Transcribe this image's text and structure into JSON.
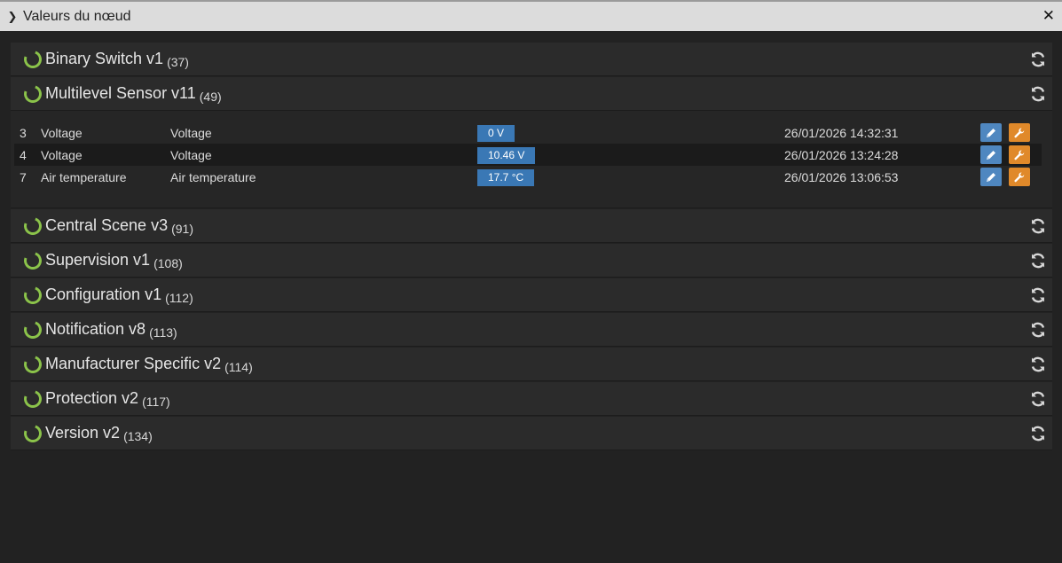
{
  "window": {
    "title": "Valeurs du nœud",
    "close_glyph": "✕"
  },
  "panels": [
    {
      "name": "Binary Switch v1",
      "id": "(37)"
    },
    {
      "name": "Multilevel Sensor v11",
      "id": "(49)",
      "rows": [
        {
          "index": "3",
          "label": "Voltage",
          "name": "Voltage",
          "value": "0 V",
          "date": "26/01/2026 14:32:31"
        },
        {
          "index": "4",
          "label": "Voltage",
          "name": "Voltage",
          "value": "10.46 V",
          "date": "26/01/2026 13:24:28"
        },
        {
          "index": "7",
          "label": "Air temperature",
          "name": "Air temperature",
          "value": "17.7 °C",
          "date": "26/01/2026 13:06:53"
        }
      ]
    },
    {
      "name": "Central Scene v3",
      "id": "(91)"
    },
    {
      "name": "Supervision v1",
      "id": "(108)"
    },
    {
      "name": "Configuration v1",
      "id": "(112)"
    },
    {
      "name": "Notification v8",
      "id": "(113)"
    },
    {
      "name": "Manufacturer Specific v2",
      "id": "(114)"
    },
    {
      "name": "Protection v2",
      "id": "(117)"
    },
    {
      "name": "Version v2",
      "id": "(134)"
    }
  ],
  "icons": {
    "status": "status-ring-icon",
    "refresh": "refresh-icon",
    "edit": "pencil-icon",
    "settings": "wrench-icon"
  },
  "colors": {
    "status_ring": "#8bc34a",
    "value_badge": "#3a78b5",
    "edit_button": "#4f87c0",
    "settings_button": "#e0892a"
  }
}
